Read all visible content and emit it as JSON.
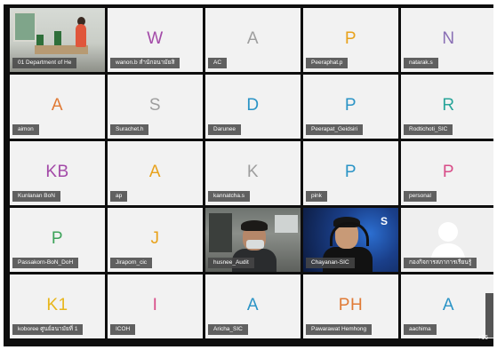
{
  "participants": [
    {
      "type": "video-office",
      "name": "01 Department of He"
    },
    {
      "type": "initials",
      "initials": "W",
      "color": "#a34aa8",
      "name": "wanon.b สำนักอนามัยสิ"
    },
    {
      "type": "initials",
      "initials": "A",
      "color": "#9e9e9e",
      "name": "AC"
    },
    {
      "type": "initials",
      "initials": "P",
      "color": "#e8a21c",
      "name": "Peeraphat.p"
    },
    {
      "type": "initials",
      "initials": "N",
      "color": "#8a6fb5",
      "name": "natarak.s"
    },
    {
      "type": "initials",
      "initials": "A",
      "color": "#e07a35",
      "name": "aimon"
    },
    {
      "type": "initials",
      "initials": "S",
      "color": "#9e9e9e",
      "name": "Surachet.h"
    },
    {
      "type": "initials",
      "initials": "D",
      "color": "#2b94c6",
      "name": "Darunee"
    },
    {
      "type": "initials",
      "initials": "P",
      "color": "#2b94c6",
      "name": "Peerapat_Geidsiri"
    },
    {
      "type": "initials",
      "initials": "R",
      "color": "#2aa59a",
      "name": "Rodtichoti_SIC"
    },
    {
      "type": "initials",
      "initials": "KB",
      "color": "#a34aa8",
      "name": "Kunlanan BoN"
    },
    {
      "type": "initials",
      "initials": "A",
      "color": "#e8a21c",
      "name": "ap"
    },
    {
      "type": "initials",
      "initials": "K",
      "color": "#9e9e9e",
      "name": "kannatcha.s"
    },
    {
      "type": "initials",
      "initials": "P",
      "color": "#2b94c6",
      "name": "pink"
    },
    {
      "type": "initials",
      "initials": "P",
      "color": "#d84c88",
      "name": "personal"
    },
    {
      "type": "initials",
      "initials": "P",
      "color": "#3da35a",
      "name": "Passakorn-BoN_DoH"
    },
    {
      "type": "initials",
      "initials": "J",
      "color": "#e8a21c",
      "name": "Jiraporn_cic"
    },
    {
      "type": "video-husnee",
      "name": "husnee_Audit"
    },
    {
      "type": "video-chay",
      "name": "Chayanan-SIC",
      "logo": "S"
    },
    {
      "type": "avatar",
      "name": "กองกิจการสภาการเรียนรู้"
    },
    {
      "type": "initials",
      "initials": "K1",
      "color": "#e8b61c",
      "name": "koboree ศูนย์อนามัยที่ 1"
    },
    {
      "type": "initials",
      "initials": "I",
      "color": "#d84c88",
      "name": "ICOH"
    },
    {
      "type": "initials",
      "initials": "A",
      "color": "#2b94c6",
      "name": "Aricha_SIC"
    },
    {
      "type": "initials",
      "initials": "PH",
      "color": "#e07a35",
      "name": "Pawarawat Hemhong"
    },
    {
      "type": "initials",
      "initials": "A",
      "color": "#2b94c6",
      "name": "aachima"
    }
  ],
  "overflow_count": "+16"
}
